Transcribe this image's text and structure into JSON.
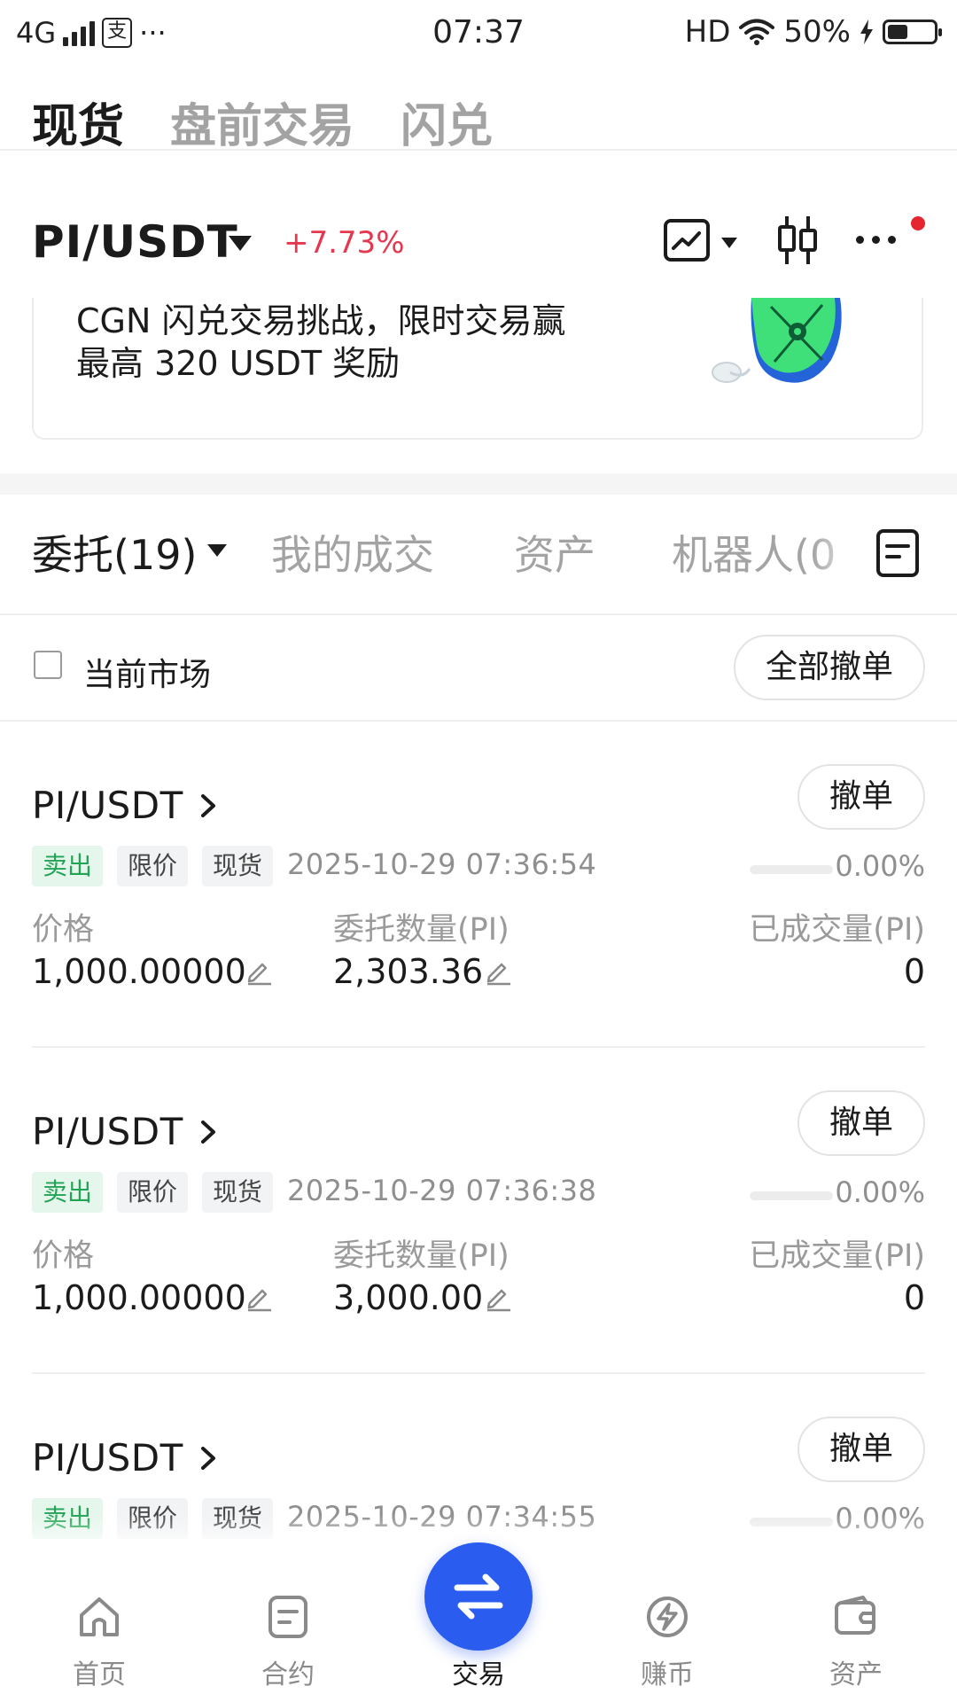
{
  "status_bar": {
    "network": "4G",
    "pay_icon_label": "支",
    "more": "···",
    "time": "07:37",
    "hd": "HD",
    "battery_text": "50%",
    "battery_level": 0.5
  },
  "top_tabs": [
    {
      "label": "现货",
      "active": true
    },
    {
      "label": "盘前交易",
      "active": false
    },
    {
      "label": "闪兑",
      "active": false
    }
  ],
  "pair_header": {
    "pair": "PI/USDT",
    "change": "+7.73%",
    "change_color": "#e5384f"
  },
  "banner": {
    "line1": "CGN 闪兑交易挑战，限时交易赢",
    "line2": "最高 320 USDT 奖励"
  },
  "order_tabs": [
    {
      "label": "委托(19)",
      "active": true
    },
    {
      "label": "我的成交",
      "active": false
    },
    {
      "label": "资产",
      "active": false
    },
    {
      "label": "机器人(0",
      "active": false
    }
  ],
  "filter": {
    "current_market_label": "当前市场",
    "current_market_checked": false,
    "cancel_all_label": "全部撤单"
  },
  "labels": {
    "cancel": "撤单",
    "price": "价格",
    "amount": "委托数量(PI)",
    "filled": "已成交量(PI)"
  },
  "orders": [
    {
      "pair": "PI/USDT",
      "side": "卖出",
      "order_type": "限价",
      "market": "现货",
      "time": "2025-10-29 07:36:54",
      "progress": "0.00%",
      "price": "1,000.00000",
      "amount": "2,303.36",
      "filled": "0"
    },
    {
      "pair": "PI/USDT",
      "side": "卖出",
      "order_type": "限价",
      "market": "现货",
      "time": "2025-10-29 07:36:38",
      "progress": "0.00%",
      "price": "1,000.00000",
      "amount": "3,000.00",
      "filled": "0"
    },
    {
      "pair": "PI/USDT",
      "side": "卖出",
      "order_type": "限价",
      "market": "现货",
      "time": "2025-10-29 07:34:55",
      "progress": "0.00%",
      "price": "",
      "amount": "",
      "filled": ""
    }
  ],
  "bottom_nav": [
    {
      "label": "首页",
      "icon": "home-icon"
    },
    {
      "label": "合约",
      "icon": "contract-icon"
    },
    {
      "label": "交易",
      "icon": "swap-arrows-icon",
      "active": true
    },
    {
      "label": "赚币",
      "icon": "earn-icon"
    },
    {
      "label": "资产",
      "icon": "wallet-icon"
    }
  ],
  "colors": {
    "accent_blue": "#2b5cf0",
    "sell_green": "#23a455",
    "change_red": "#e5384f"
  }
}
